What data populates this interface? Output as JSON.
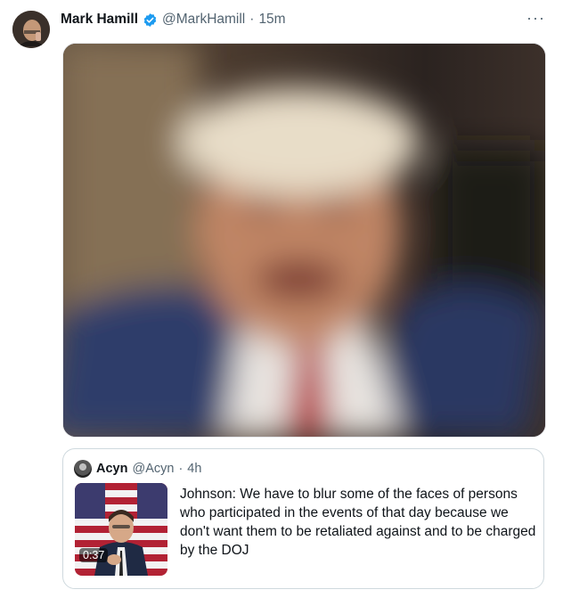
{
  "tweet": {
    "author_name": "Mark Hamill",
    "author_handle": "@MarkHamill",
    "separator": "·",
    "time": "15m",
    "more_label": "···",
    "verified_color": "#1d9bf0"
  },
  "quoted": {
    "author_name": "Acyn",
    "author_handle": "@Acyn",
    "separator": "·",
    "time": "4h",
    "video_duration": "0:37",
    "text": "Johnson: We have to blur some of the faces of persons who participated in the events of that day because we don't want them to be retaliated against and to be charged by the DOJ"
  }
}
